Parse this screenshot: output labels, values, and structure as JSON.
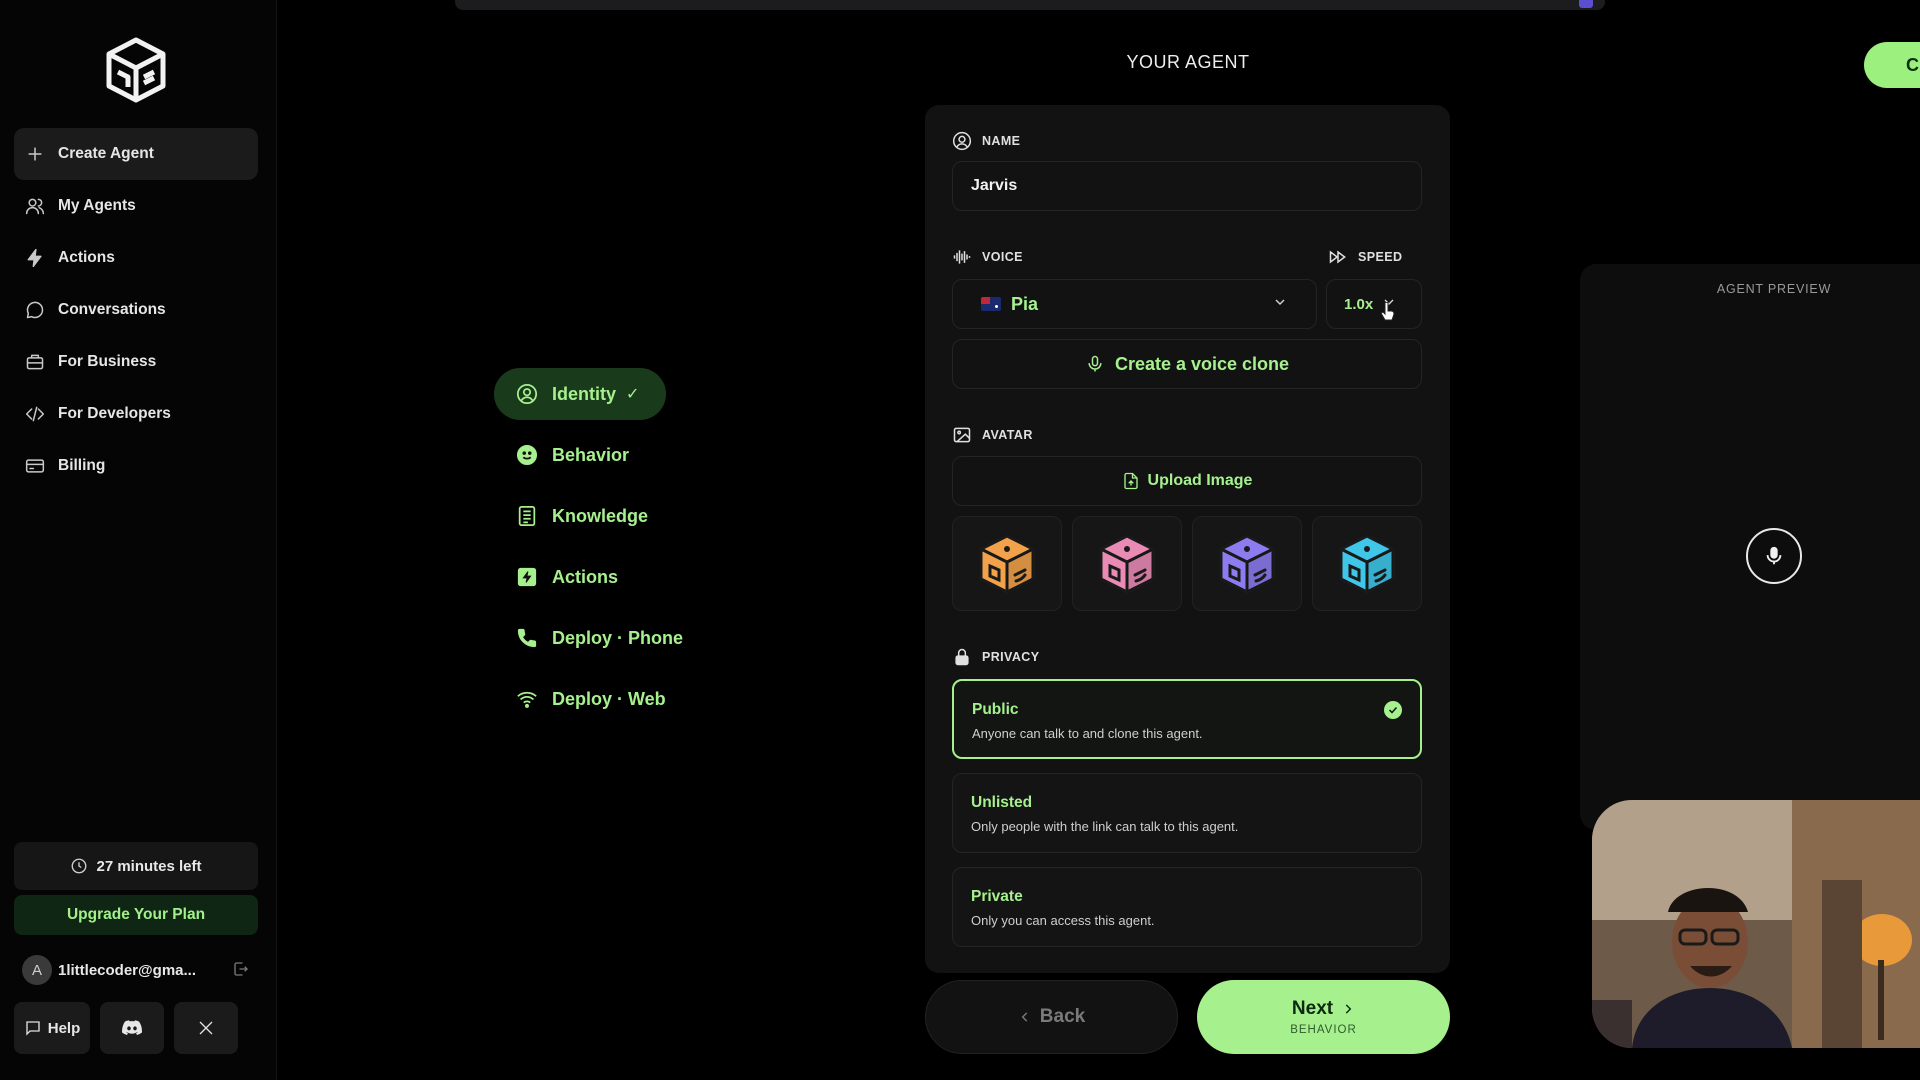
{
  "sidebar": {
    "nav": [
      {
        "label": "Create Agent",
        "icon": "plus-icon"
      },
      {
        "label": "My Agents",
        "icon": "users-icon"
      },
      {
        "label": "Actions",
        "icon": "bolt-icon"
      },
      {
        "label": "Conversations",
        "icon": "chat-icon"
      },
      {
        "label": "For Business",
        "icon": "briefcase-icon"
      },
      {
        "label": "For Developers",
        "icon": "code-icon"
      },
      {
        "label": "Billing",
        "icon": "card-icon"
      }
    ],
    "time_left": "27 minutes left",
    "upgrade": "Upgrade Your Plan",
    "account_initial": "A",
    "account_email": "1littlecoder@gma...",
    "help": "Help"
  },
  "header": {
    "title": "YOUR AGENT",
    "top_right_button": "C"
  },
  "steps": [
    {
      "label": "Identity",
      "active": true,
      "done": true
    },
    {
      "label": "Behavior"
    },
    {
      "label": "Knowledge"
    },
    {
      "label": "Actions"
    },
    {
      "label": "Deploy · Phone"
    },
    {
      "label": "Deploy · Web"
    }
  ],
  "step_check": "✓",
  "form": {
    "name_label": "NAME",
    "name_value": "Jarvis",
    "voice_label": "VOICE",
    "speed_label": "SPEED",
    "voice_value": "Pia",
    "speed_value": "1.0x",
    "clone_button": "Create a voice clone",
    "avatar_label": "AVATAR",
    "upload_button": "Upload Image",
    "avatar_colors": [
      "#f2a24b",
      "#e98bb5",
      "#8c7cf0",
      "#3fc6e8"
    ],
    "privacy_label": "PRIVACY",
    "privacy_options": [
      {
        "title": "Public",
        "desc": "Anyone can talk to and clone this agent.",
        "selected": true
      },
      {
        "title": "Unlisted",
        "desc": "Only people with the link can talk to this agent."
      },
      {
        "title": "Private",
        "desc": "Only you can access this agent."
      }
    ]
  },
  "footer": {
    "back": "Back",
    "next": "Next",
    "next_sub": "BEHAVIOR"
  },
  "preview": {
    "title": "AGENT PREVIEW"
  },
  "colors": {
    "accent": "#a6f08e",
    "panel": "#121212",
    "background": "#000000"
  }
}
